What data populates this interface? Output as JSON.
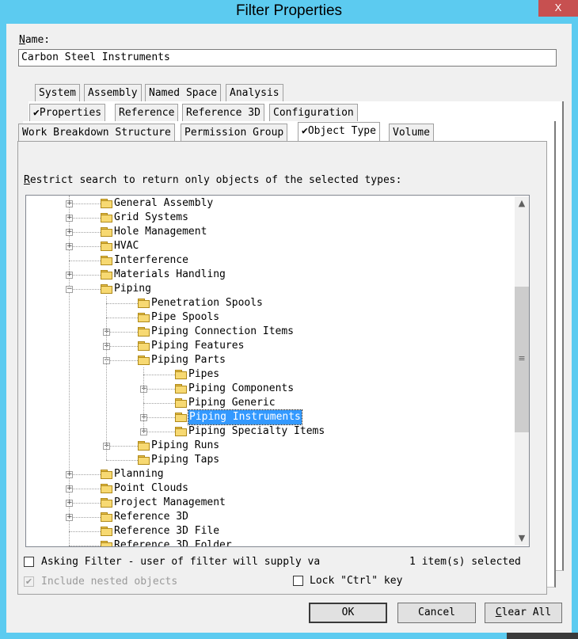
{
  "window": {
    "title": "Filter Properties",
    "close_glyph": "X"
  },
  "name_field": {
    "label": "Name:",
    "value": "Carbon Steel Instruments"
  },
  "tabs": {
    "row1": [
      "System",
      "Assembly",
      "Named Space",
      "Analysis"
    ],
    "row2": [
      "Properties",
      "Reference",
      "Reference 3D",
      "Configuration"
    ],
    "row3": [
      "Work Breakdown Structure",
      "Permission Group",
      "Object Type",
      "Volume"
    ],
    "active": "Object Type",
    "check_glyph": "✔"
  },
  "content": {
    "instruction": "Restrict search to return only objects of the selected types:",
    "tree": [
      {
        "label": "General Assembly",
        "level": 1,
        "expander": "+"
      },
      {
        "label": "Grid Systems",
        "level": 1,
        "expander": "+"
      },
      {
        "label": "Hole Management",
        "level": 1,
        "expander": "+"
      },
      {
        "label": "HVAC",
        "level": 1,
        "expander": "+"
      },
      {
        "label": "Interference",
        "level": 1,
        "expander": ""
      },
      {
        "label": "Materials Handling",
        "level": 1,
        "expander": "+"
      },
      {
        "label": "Piping",
        "level": 1,
        "expander": "-"
      },
      {
        "label": "Penetration Spools",
        "level": 2,
        "expander": ""
      },
      {
        "label": "Pipe Spools",
        "level": 2,
        "expander": ""
      },
      {
        "label": "Piping Connection Items",
        "level": 2,
        "expander": "+"
      },
      {
        "label": "Piping Features",
        "level": 2,
        "expander": "+"
      },
      {
        "label": "Piping Parts",
        "level": 2,
        "expander": "-"
      },
      {
        "label": "Pipes",
        "level": 3,
        "expander": ""
      },
      {
        "label": "Piping Components",
        "level": 3,
        "expander": "+"
      },
      {
        "label": "Piping Generic",
        "level": 3,
        "expander": ""
      },
      {
        "label": "Piping Instruments",
        "level": 3,
        "expander": "+",
        "selected": true
      },
      {
        "label": "Piping Specialty Items",
        "level": 3,
        "expander": "+"
      },
      {
        "label": "Piping Runs",
        "level": 2,
        "expander": "+"
      },
      {
        "label": "Piping Taps",
        "level": 2,
        "expander": ""
      },
      {
        "label": "Planning",
        "level": 1,
        "expander": "+"
      },
      {
        "label": "Point Clouds",
        "level": 1,
        "expander": "+"
      },
      {
        "label": "Project Management",
        "level": 1,
        "expander": "+"
      },
      {
        "label": "Reference 3D",
        "level": 1,
        "expander": "+"
      },
      {
        "label": "Reference 3D File",
        "level": 1,
        "expander": ""
      },
      {
        "label": "Reference 3D Folder",
        "level": 1,
        "expander": ""
      }
    ],
    "asking_filter": {
      "label": "Asking Filter - user of filter will supply va",
      "checked": false
    },
    "selection_count": "1 item(s) selected",
    "include_nested": {
      "label": "Include nested objects",
      "checked": true,
      "disabled": true
    },
    "lock_ctrl": {
      "label": "Lock \"Ctrl\" key",
      "checked": false
    }
  },
  "buttons": {
    "ok": "OK",
    "cancel": "Cancel",
    "clear_all": "Clear All"
  },
  "scroll": {
    "up_glyph": "▲",
    "down_glyph": "▼",
    "grip_glyph": "≡"
  },
  "colors": {
    "title_bar": "#5ccbf0",
    "selection": "#3399ff",
    "close": "#c75050"
  }
}
